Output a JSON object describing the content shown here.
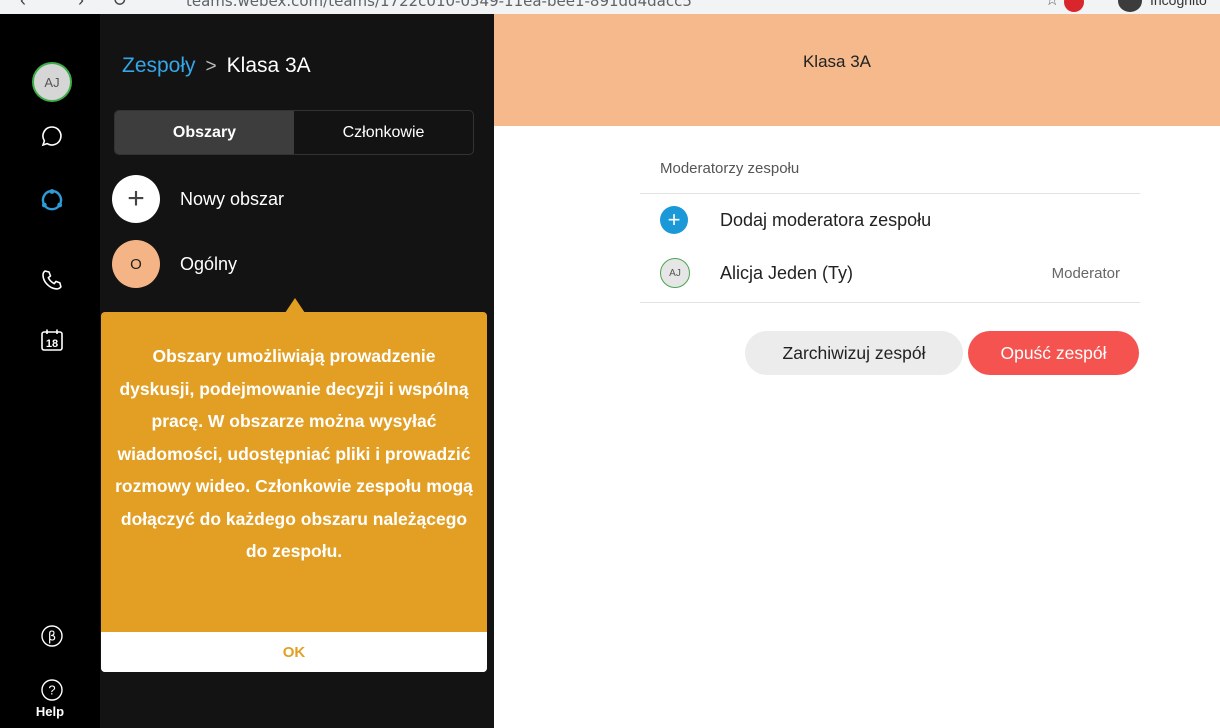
{
  "browser": {
    "url_text": "teams.webex.com/teams/1722c010-0549-11ea-bee1-891dd4dacc5",
    "incognito_label": "Incognito"
  },
  "rail": {
    "avatar_initials": "AJ",
    "calendar_day": "18",
    "help_label": "Help",
    "beta_glyph": "β"
  },
  "breadcrumb": {
    "parent": "Zespoły",
    "separator": ">",
    "current": "Klasa 3A"
  },
  "tabs": [
    "Obszary",
    "Członkowie"
  ],
  "spaces": [
    {
      "initial": "+",
      "label": "Nowy obszar"
    },
    {
      "initial": "O",
      "label": "Ogólny"
    }
  ],
  "tooltip": {
    "text": "Obszary umożliwiają prowadzenie dyskusji, podejmowanie decyzji i wspólną pracę. W obszarze można wysyłać wiadomości, udostępniać pliki i prowadzić rozmowy wideo. Członkowie zespołu mogą dołączyć do każdego obszaru należącego do zespołu.",
    "ok_label": "OK"
  },
  "team_header": {
    "title": "Klasa 3A",
    "color": "#f5b98b"
  },
  "moderators": {
    "section_label": "Moderatorzy zespołu",
    "add_label": "Dodaj moderatora zespołu",
    "members": [
      {
        "initials": "AJ",
        "name": "Alicja Jeden (Ty)",
        "role": "Moderator"
      }
    ]
  },
  "actions": {
    "archive_label": "Zarchiwizuj zespół",
    "leave_label": "Opuść zespół",
    "leave_color": "#f4534f"
  }
}
